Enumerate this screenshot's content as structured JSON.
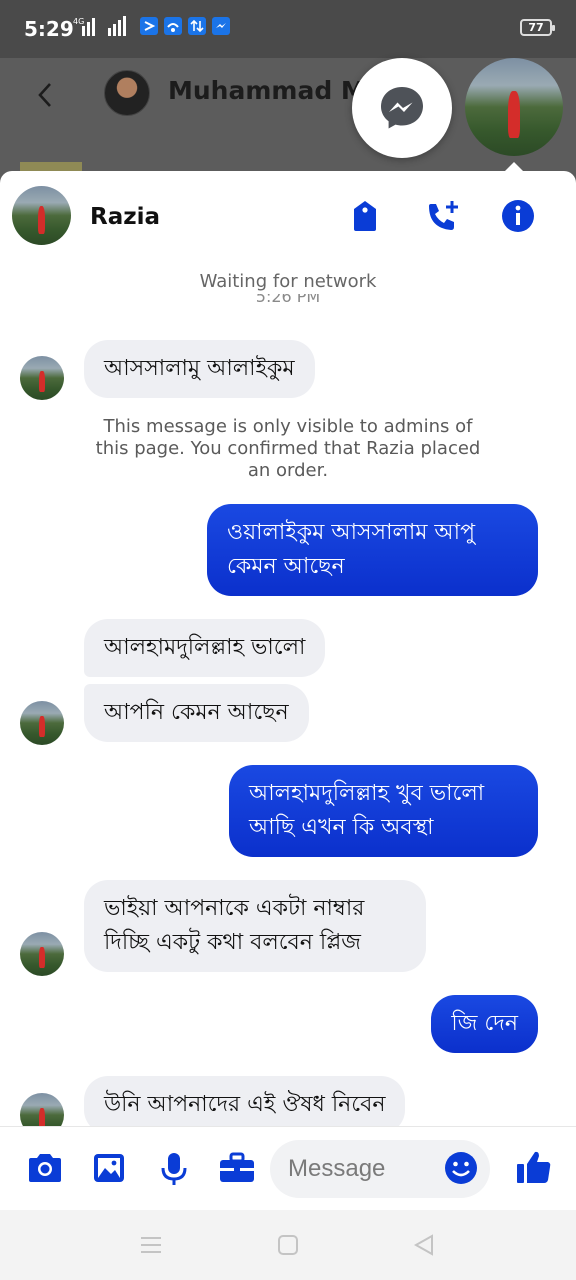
{
  "status_bar": {
    "time": "5:29",
    "network": "4G",
    "battery": "77",
    "icons": [
      "signal-icon",
      "wifi-icon",
      "app-icon",
      "data-transfer-icon",
      "messenger-icon"
    ]
  },
  "background_page": {
    "contact_name": "Muhammad M"
  },
  "chat": {
    "contact_name": "Razia",
    "header_icons": [
      "tag-icon",
      "add-call-icon",
      "info-icon"
    ],
    "network_status": "Waiting for network",
    "partial_timestamp": "5:26 PM",
    "admin_note": "This message is only visible to admins of this page. You confirmed that Razia placed an order.",
    "messages": [
      {
        "from": "contact",
        "text": "আসসালামু আলাইকুম"
      },
      {
        "from": "me",
        "text": "ওয়ালাইকুম আসসালাম আপু কেমন আছেন"
      },
      {
        "from": "contact",
        "text": "আলহামদুলিল্লাহ ভালো"
      },
      {
        "from": "contact",
        "text": "আপনি কেমন আছেন"
      },
      {
        "from": "me",
        "text": "আলহামদুলিল্লাহ খুব ভালো আছি এখন কি অবস্থা"
      },
      {
        "from": "contact",
        "text": "ভাইয়া আপনাকে একটা নাম্বার দিচ্ছি একটু কথা বলবেন প্লিজ"
      },
      {
        "from": "me",
        "text": "জি দেন"
      },
      {
        "from": "contact",
        "text": "উনি আপনাদের এই ঔষধ নিবেন"
      }
    ]
  },
  "composer": {
    "placeholder": "Message",
    "icons": [
      "camera-icon",
      "gallery-icon",
      "microphone-icon",
      "briefcase-icon",
      "emoji-icon",
      "thumbs-up-icon"
    ]
  },
  "colors": {
    "accent": "#0a3cd6",
    "bubble_incoming": "#eeeff3",
    "bubble_outgoing": "#1a49e2"
  }
}
